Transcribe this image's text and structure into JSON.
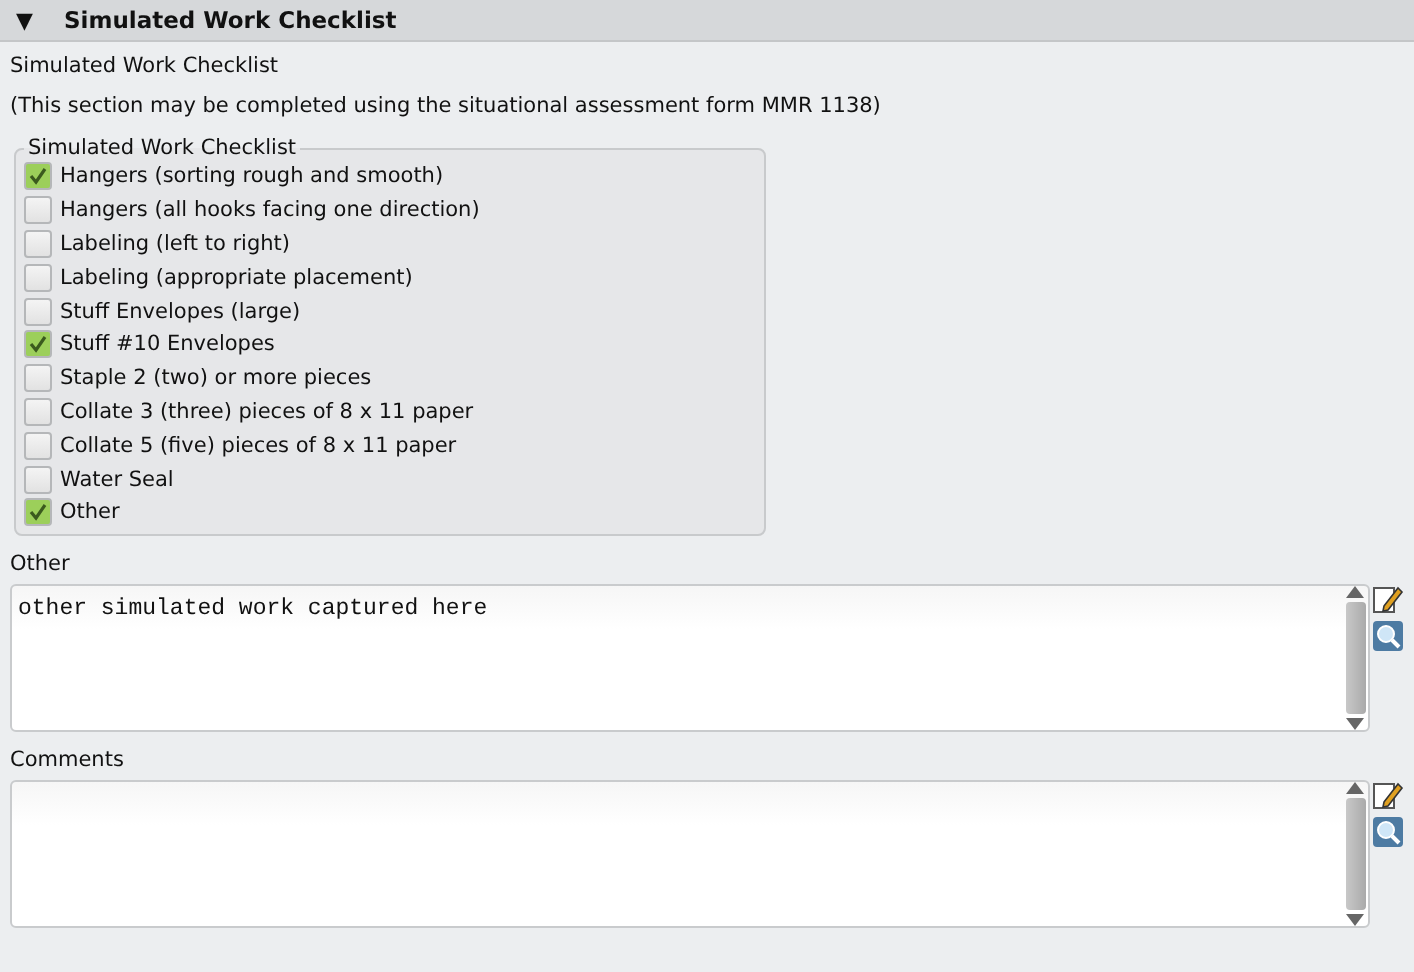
{
  "section": {
    "title": "Simulated Work Checklist",
    "expanded": true,
    "toggle": "▼"
  },
  "heading": "Simulated Work Checklist",
  "note": "(This section may be completed using the situational assessment form MMR 1138)",
  "checklist": {
    "legend": "Simulated Work Checklist",
    "items": [
      {
        "label": "Hangers (sorting rough and smooth)",
        "checked": true
      },
      {
        "label": "Hangers (all hooks facing one direction)",
        "checked": false
      },
      {
        "label": "Labeling (left to right)",
        "checked": false
      },
      {
        "label": "Labeling (appropriate placement)",
        "checked": false
      },
      {
        "label": "Stuff Envelopes (large)",
        "checked": false
      },
      {
        "label": "Stuff #10 Envelopes",
        "checked": true
      },
      {
        "label": "Staple 2 (two) or more pieces",
        "checked": false
      },
      {
        "label": "Collate 3 (three) pieces of 8 x 11 paper",
        "checked": false
      },
      {
        "label": "Collate 5 (five) pieces of 8 x 11 paper",
        "checked": false
      },
      {
        "label": "Water Seal",
        "checked": false
      },
      {
        "label": "Other",
        "checked": true
      }
    ]
  },
  "fields": [
    {
      "label": "Other",
      "value": "other simulated work captured here"
    },
    {
      "label": "Comments"
    }
  ]
}
